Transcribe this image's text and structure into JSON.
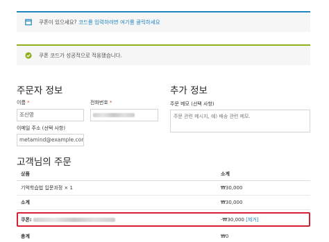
{
  "notices": {
    "coupon_prompt_text": "쿠폰이 있으세요? ",
    "coupon_prompt_link": "코드를 입력하려면 여기를 클릭하세요",
    "success_text": "쿠폰 코드가 성공적으로 적용됐습니다."
  },
  "billing": {
    "heading": "주문자 정보",
    "name_label": "이름",
    "name_value": "조신영",
    "phone_label": "전화번호",
    "required_mark": "*",
    "email_label": "이메일 주소 (선택 사항)",
    "email_value": "metamind@example.com"
  },
  "additional": {
    "heading": "추가 정보",
    "memo_label": "주문 메모 (선택 사항)",
    "memo_placeholder": "주문 관련 메시지, 예) 배송 관련 메모."
  },
  "order": {
    "heading": "고객님의 주문",
    "col_product": "상품",
    "col_total": "소계",
    "item_name": "기억학습법 입문과정",
    "item_qty": "× 1",
    "item_price": "₩30,000",
    "subtotal_label": "소계",
    "subtotal_value": "₩30,000",
    "coupon_label": "쿠폰:",
    "coupon_discount": "-₩30,000",
    "coupon_remove": "[제거]",
    "total_label": "총계",
    "total_value": "₩0"
  },
  "colors": {
    "info_accent": "#1e85be",
    "success_accent": "#8fae1b",
    "required": "#e2401c",
    "coupon_highlight": "#d81e35"
  }
}
